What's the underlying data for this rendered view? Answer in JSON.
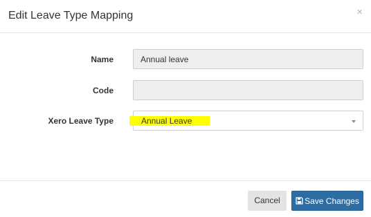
{
  "dialog": {
    "title": "Edit Leave Type Mapping",
    "close_glyph": "×"
  },
  "form": {
    "name": {
      "label": "Name",
      "value": "Annual leave"
    },
    "code": {
      "label": "Code",
      "value": ""
    },
    "xero_leave_type": {
      "label": "Xero Leave Type",
      "selected": "Annual Leave"
    }
  },
  "footer": {
    "cancel_label": "Cancel",
    "save_label": "Save Changes"
  },
  "colors": {
    "primary": "#2e6da4",
    "highlight": "#ffff00",
    "readonly_bg": "#eeeeee"
  },
  "icons": {
    "save": "floppy-disk-icon",
    "close": "close-icon",
    "caret": "caret-down-icon"
  }
}
